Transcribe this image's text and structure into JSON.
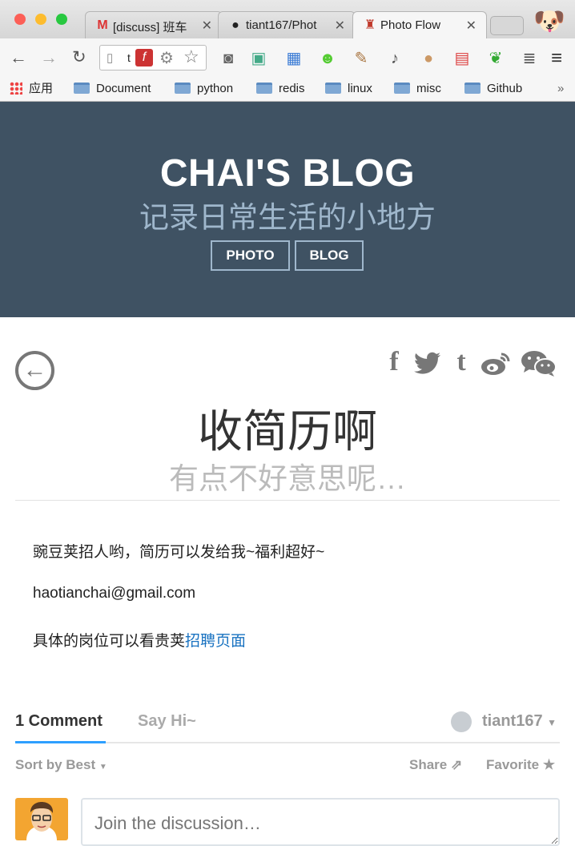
{
  "browser": {
    "tabs": [
      {
        "label": "[discuss] 班车",
        "favicon": "gmail-icon"
      },
      {
        "label": "tiant167/Phot",
        "favicon": "github-icon"
      },
      {
        "label": "Photo Flow",
        "favicon": "hat-icon"
      }
    ],
    "url_text": "t",
    "bookmarks": [
      "应用",
      "Document",
      "python",
      "redis",
      "linux",
      "misc",
      "Github"
    ],
    "bookmarks_overflow": "»"
  },
  "hero": {
    "title": "CHAI'S BLOG",
    "subtitle": "记录日常生活的小地方",
    "nav": [
      "PHOTO",
      "BLOG"
    ]
  },
  "post": {
    "title": "收简历啊",
    "subtitle": "有点不好意思呢…",
    "paragraphs": [
      "豌豆荚招人哟，简历可以发给我~福利超好~",
      "haotianchai@gmail.com"
    ],
    "para3_text": "具体的岗位可以看贵荚",
    "para3_link": "招聘页面",
    "share_icons": [
      "facebook-icon",
      "twitter-icon",
      "tumblr-icon",
      "weibo-icon",
      "wechat-icon"
    ]
  },
  "comments": {
    "tab_count": "1 Comment",
    "tab_other": "Say Hi~",
    "user": "tiant167",
    "sort": "Sort by Best",
    "share": "Share",
    "favorite": "Favorite",
    "placeholder": "Join the discussion…"
  },
  "colors": {
    "hero_bg": "#3f5263",
    "link": "#1a73c1",
    "accent": "#2e9fff"
  }
}
